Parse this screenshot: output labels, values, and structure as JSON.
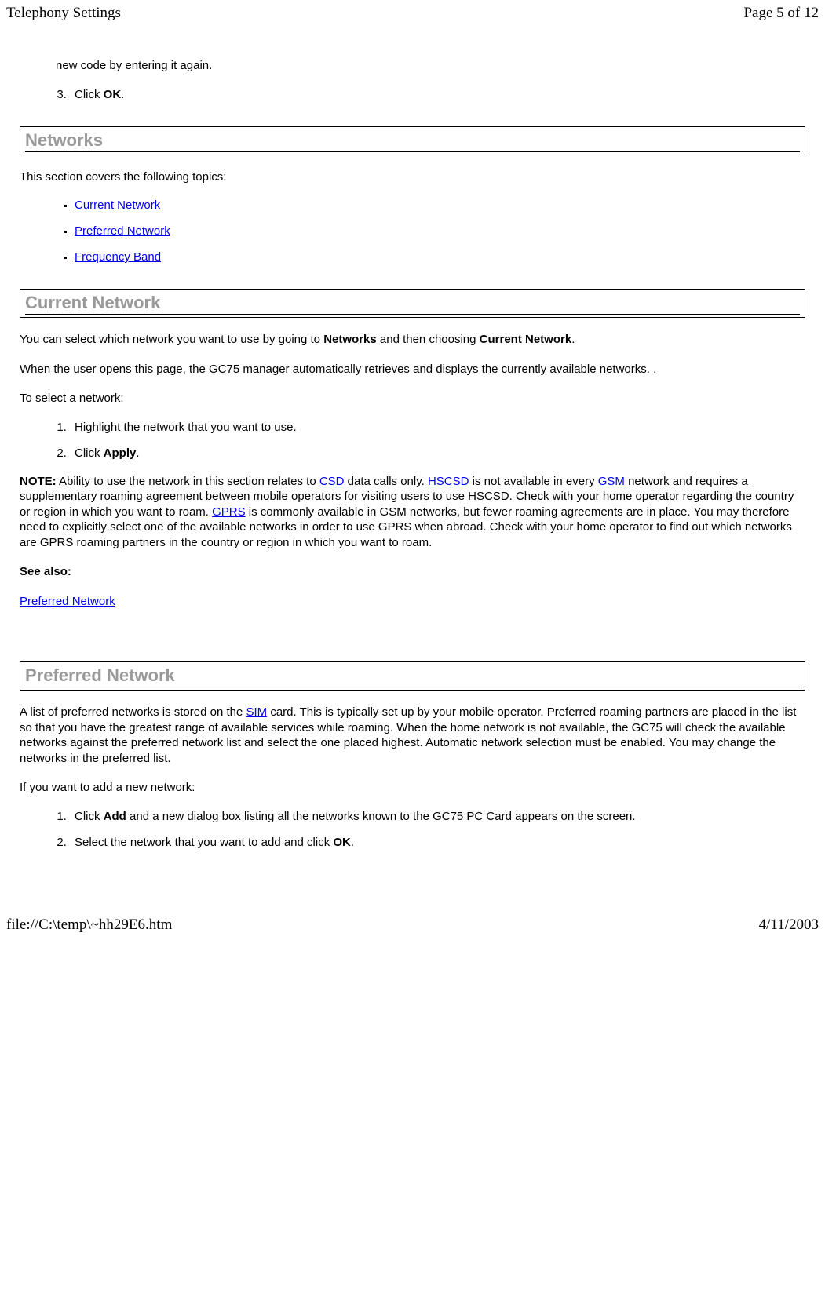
{
  "header": {
    "title": "Telephony Settings",
    "page_info": "Page 5 of 12"
  },
  "footer": {
    "path": "file://C:\\temp\\~hh29E6.htm",
    "date": "4/11/2003"
  },
  "content": {
    "continuation_text": "new code by entering it again.",
    "step3_prefix": "Click ",
    "step3_bold": "OK",
    "step3_suffix": ".",
    "networks": {
      "heading": "Networks",
      "intro": "This section covers the following topics:",
      "topics": [
        "Current Network",
        "Preferred Network",
        "Frequency Band"
      ]
    },
    "current_network": {
      "heading": "Current Network",
      "p1_prefix": "You can select which network you want to use by going to ",
      "p1_bold1": "Networks",
      "p1_mid": " and then choosing ",
      "p1_bold2": "Current Network",
      "p1_suffix": ".",
      "p2": "When the user opens this page, the GC75 manager automatically retrieves and displays the currently available networks. .",
      "p3": "To select a network:",
      "step1": "Highlight the network that you want to use.",
      "step2_prefix": "Click ",
      "step2_bold": "Apply",
      "step2_suffix": ".",
      "note_label": "NOTE:",
      "note_t1": " Ability to use the network in this section relates to ",
      "note_link1": "CSD",
      "note_t2": " data calls only. ",
      "note_link2": "HSCSD",
      "note_t3": " is not available in every ",
      "note_link3": "GSM",
      "note_t4": " network and requires a supplementary roaming agreement between mobile operators for visiting users to use HSCSD. Check with your home operator regarding the country or region in which you want to roam. ",
      "note_link4": "GPRS",
      "note_t5": " is commonly available in GSM networks, but fewer roaming agreements are in place. You may therefore need to explicitly select one of the available networks in order to use GPRS when abroad. Check with your home operator to find out which networks are GPRS roaming partners in the country or region in which you want to roam.",
      "see_also_label": "See also:",
      "see_also_link": "Preferred Network"
    },
    "preferred_network": {
      "heading": "Preferred Network",
      "p1_t1": "A list of preferred networks is stored on the ",
      "p1_link1": "SIM",
      "p1_t2": " card. This is typically set up by your mobile operator. Preferred roaming partners are placed in the list so that you have the greatest range of available services while roaming. When the home network is not available, the GC75 will check the available networks against the preferred network list and select the one placed highest. Automatic network selection must be enabled. You may change the networks in the preferred list.",
      "p2": "If you want to add a new network:",
      "step1_prefix": "Click ",
      "step1_bold": "Add",
      "step1_suffix": " and a new dialog box listing all the networks known to the GC75 PC Card appears on the screen.",
      "step2_prefix": "Select the network that you want to add and click ",
      "step2_bold": "OK",
      "step2_suffix": "."
    }
  }
}
